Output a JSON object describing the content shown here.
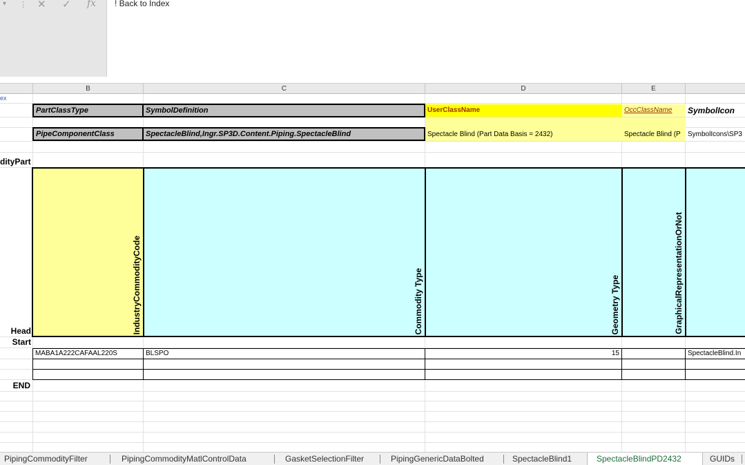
{
  "formula_bar": {
    "cancel_glyph": "✕",
    "enter_glyph": "✓",
    "fx_glyph": "fx",
    "content": "! Back to Index"
  },
  "columns": [
    "B",
    "C",
    "D",
    "E"
  ],
  "row_labels": {
    "back_link": "ex",
    "commodity_part": "dityPart",
    "head": "Head",
    "start": "Start",
    "end": "END"
  },
  "definition_row": {
    "part_class_type": "PartClassType",
    "symbol_definition": "SymbolDefinition",
    "user_class_name": "UserClassName",
    "occ_class_name": "OccClassName",
    "symbol_icon": "SymbolIcon"
  },
  "value_row": {
    "part_class_type": "PipeComponentClass",
    "symbol_definition": "SpectacleBlind,Ingr.SP3D.Content.Piping.SpectacleBlind",
    "user_class_name": "Spectacle Blind (Part Data Basis = 2432)",
    "occ_class_name": "Spectacle Blind (P",
    "symbol_icon": "SymbolIcons\\SP3"
  },
  "header_columns": [
    "IndustryCommodityCode",
    "Commodity Type",
    "Geometry Type",
    "GraphicalRepresentationOrNot"
  ],
  "data_rows": [
    {
      "industry_commodity_code": "MABA1A222CAFAAL220S",
      "commodity_type": "BLSPO",
      "geometry_type": "15",
      "graphical_representation": "",
      "symbol": "SpectacleBlind.In"
    }
  ],
  "sheet_tabs": [
    "PipingCommodityFilter",
    "PipingCommodityMatlControlData",
    "GasketSelectionFilter",
    "PipingGenericDataBolted",
    "SpectacleBlind1",
    "SpectacleBlindPD2432",
    "GUIDs"
  ],
  "active_tab": "SpectacleBlindPD2432",
  "colors": {
    "highlight_yellow": "#ffff00",
    "pale_yellow": "#ffff99",
    "pale_cyan": "#ccffff",
    "header_gray": "#c0c0c0",
    "occ_link_color": "#993300"
  }
}
